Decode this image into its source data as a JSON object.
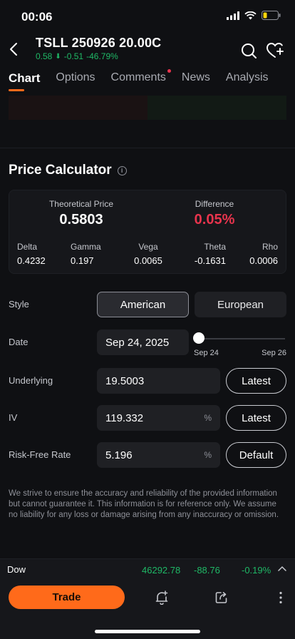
{
  "status": {
    "time": "00:06"
  },
  "header": {
    "ticker": "TSLL 250926 20.00C",
    "last": "0.58",
    "change": "-0.51",
    "change_pct": "-46.79%"
  },
  "tabs": [
    "Chart",
    "Options",
    "Comments",
    "News",
    "Analysis"
  ],
  "calculator": {
    "title": "Price Calculator",
    "theoretical_label": "Theoretical Price",
    "theoretical_value": "0.5803",
    "difference_label": "Difference",
    "difference_value": "0.05%",
    "greeks": [
      {
        "label": "Delta",
        "value": "0.4232"
      },
      {
        "label": "Gamma",
        "value": "0.197"
      },
      {
        "label": "Vega",
        "value": "0.0065"
      },
      {
        "label": "Theta",
        "value": "-0.1631"
      },
      {
        "label": "Rho",
        "value": "0.0006"
      }
    ]
  },
  "form": {
    "style_label": "Style",
    "style_american": "American",
    "style_european": "European",
    "date_label": "Date",
    "date_value": "Sep 24, 2025",
    "slider_start": "Sep 24",
    "slider_end": "Sep 26",
    "underlying_label": "Underlying",
    "underlying_value": "19.5003",
    "underlying_btn": "Latest",
    "iv_label": "IV",
    "iv_value": "119.332",
    "iv_unit": "%",
    "iv_btn": "Latest",
    "rfr_label": "Risk-Free Rate",
    "rfr_value": "5.196",
    "rfr_unit": "%",
    "rfr_btn": "Default"
  },
  "disclaimer": "We strive to ensure the accuracy and reliability of the provided information but cannot guarantee it. This information is for reference only. We assume no liability for any loss or damage arising from any inaccuracy or omission.",
  "index_bar": {
    "name": "Dow",
    "value": "46292.78",
    "change": "-88.76",
    "change_pct": "-0.19%"
  },
  "bottom": {
    "trade_label": "Trade"
  },
  "colors": {
    "accent": "#ff6a1a",
    "up_green": "#1fb866",
    "down_red": "#e8344d"
  }
}
